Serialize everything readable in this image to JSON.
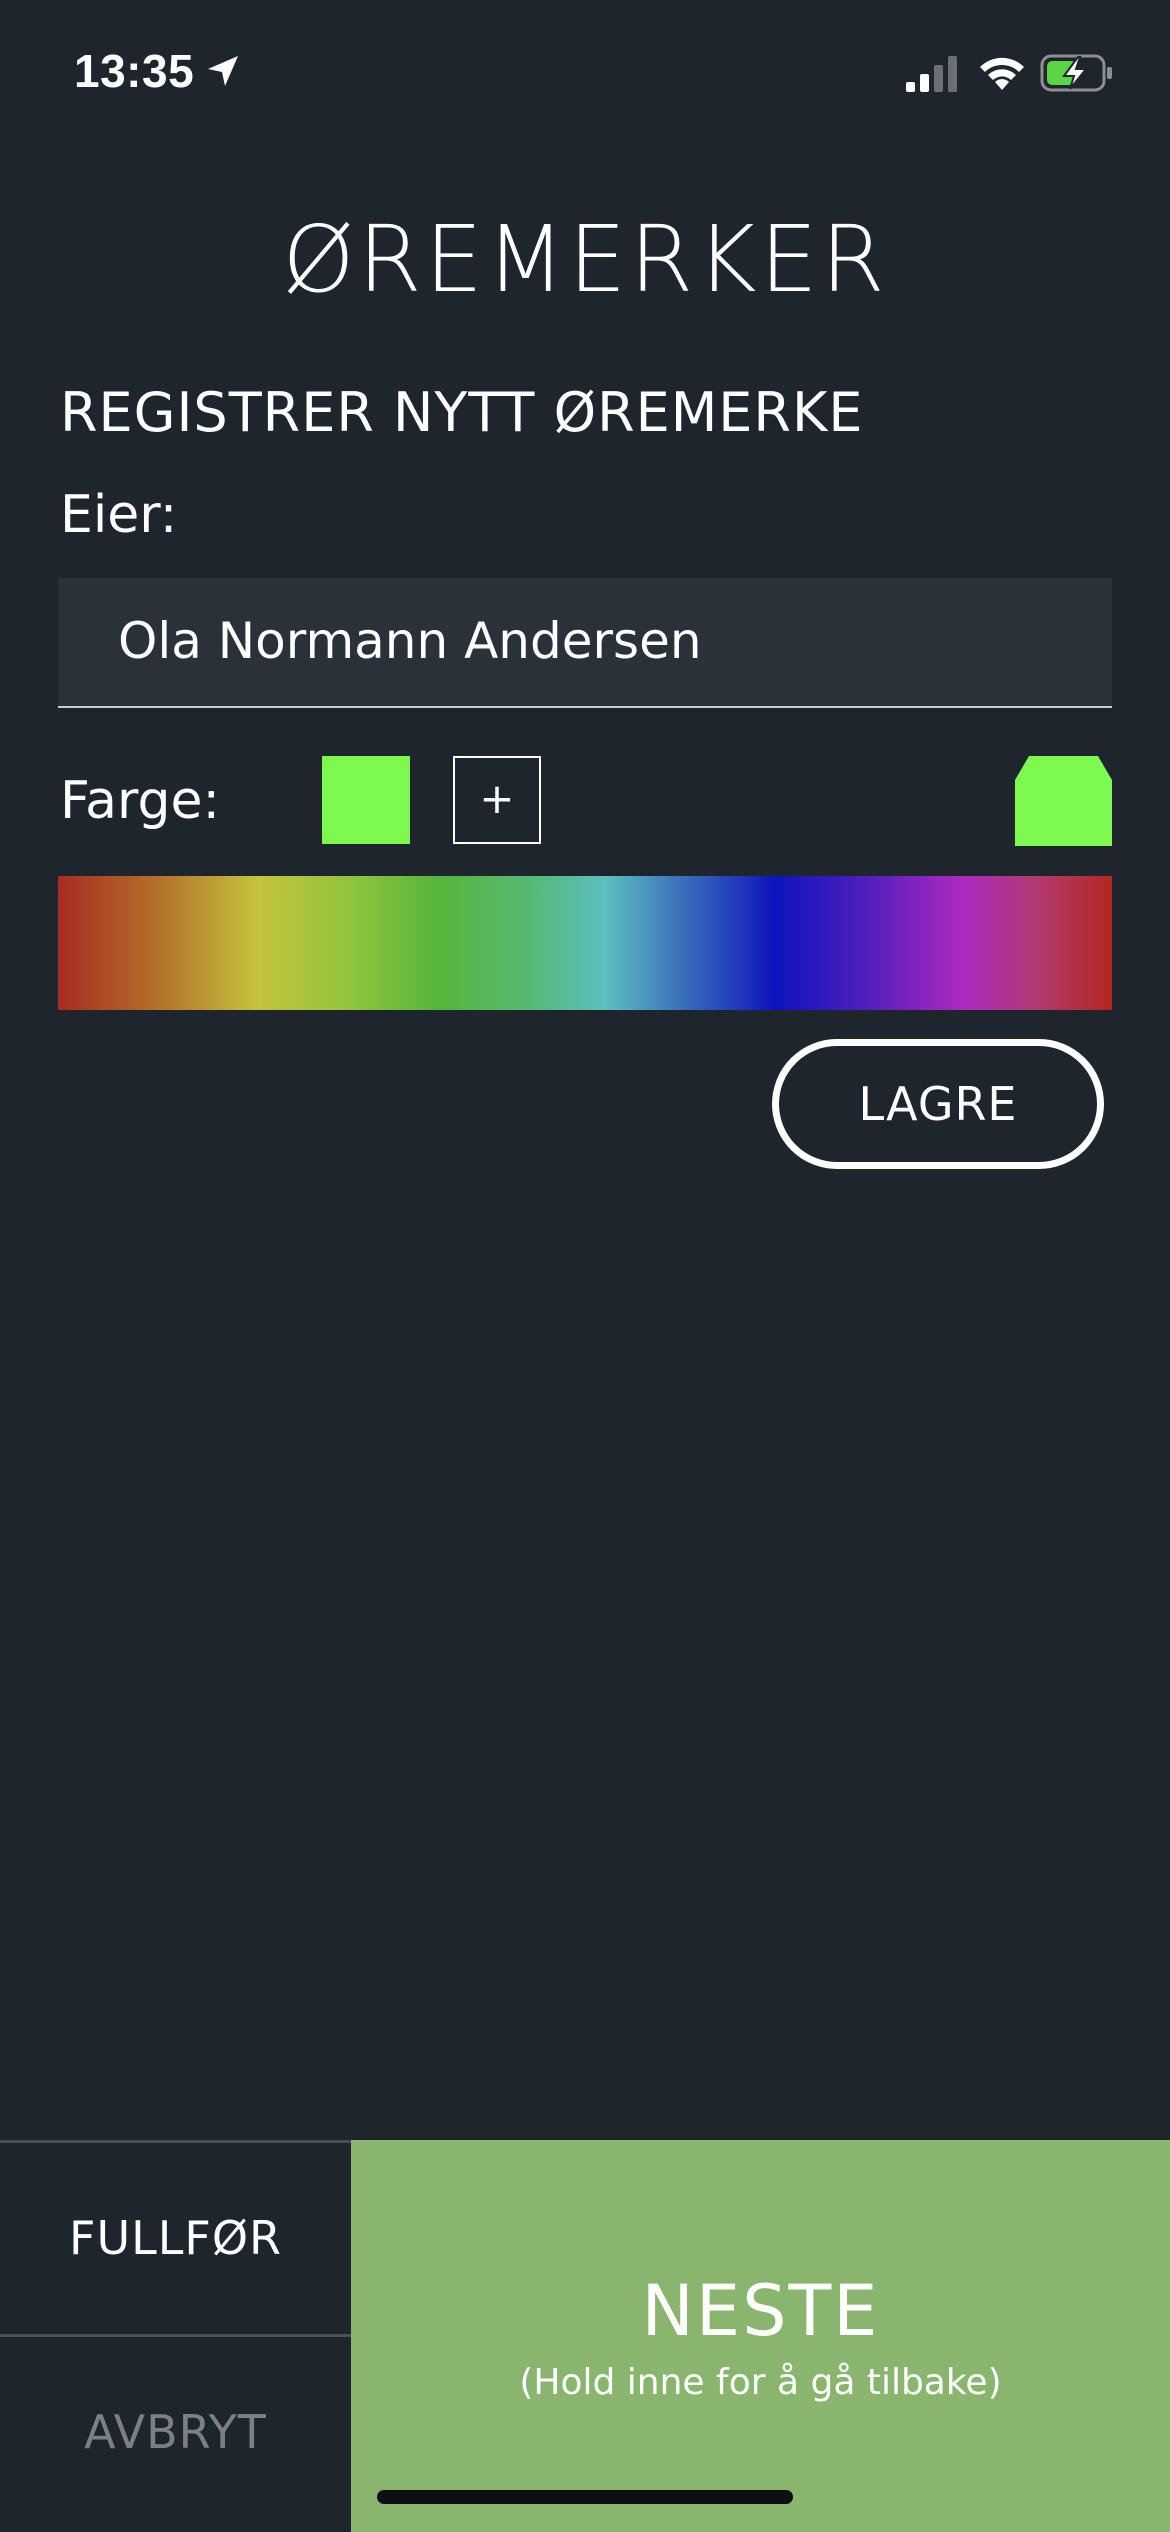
{
  "status_bar": {
    "time": "13:35",
    "icons": [
      "location-arrow-icon",
      "cellular-signal-icon",
      "wifi-icon",
      "battery-charging-icon"
    ]
  },
  "header": {
    "title": "ØREMERKER"
  },
  "form": {
    "heading": "REGISTRER NYTT ØREMERKE",
    "owner_label": "Eier:",
    "owner_value": "Ola Normann Andersen",
    "color_label": "Farge:",
    "selected_color": "#7ef94f",
    "add_color_label": "+",
    "save_label": "LAGRE"
  },
  "bottom_bar": {
    "finish_label": "FULLFØR",
    "cancel_label": "AVBRYT",
    "next_label": "NESTE",
    "next_hint": "(Hold inne for å gå tilbake)",
    "next_color": "#8ab56e"
  }
}
